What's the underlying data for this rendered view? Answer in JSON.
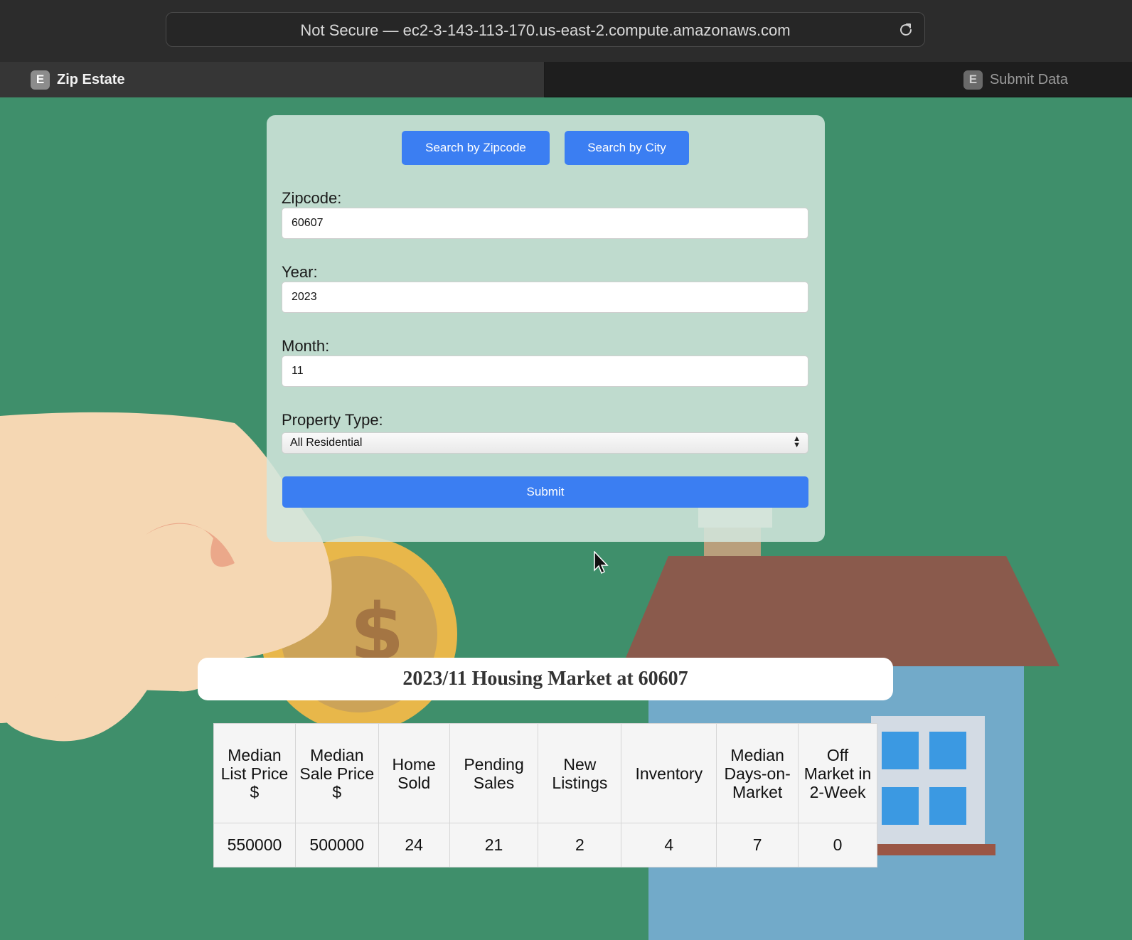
{
  "browser": {
    "url": "Not Secure — ec2-3-143-113-170.us-east-2.compute.amazonaws.com",
    "tabs": [
      {
        "favicon": "E",
        "label": "Zip Estate",
        "active": true
      },
      {
        "favicon": "E",
        "label": "Submit Data",
        "active": false
      }
    ]
  },
  "form": {
    "search_by_zip": "Search by Zipcode",
    "search_by_city": "Search by City",
    "zipcode_label": "Zipcode:",
    "zipcode_value": "60607",
    "year_label": "Year:",
    "year_value": "2023",
    "month_label": "Month:",
    "month_value": "11",
    "property_type_label": "Property Type:",
    "property_type_value": "All Residential",
    "submit_label": "Submit"
  },
  "result": {
    "title": "2023/11 Housing Market at 60607",
    "columns": [
      "Median List Price $",
      "Median Sale Price $",
      "Home Sold",
      "Pending Sales",
      "New Listings",
      "Inventory",
      "Median Days-on-Market",
      "Off Market in 2-Week"
    ],
    "values": [
      "550000",
      "500000",
      "24",
      "21",
      "2",
      "4",
      "7",
      "0"
    ]
  },
  "colors": {
    "background": "#3f8f6b",
    "button": "#3b7ef2",
    "card": "#d2e6dc"
  }
}
